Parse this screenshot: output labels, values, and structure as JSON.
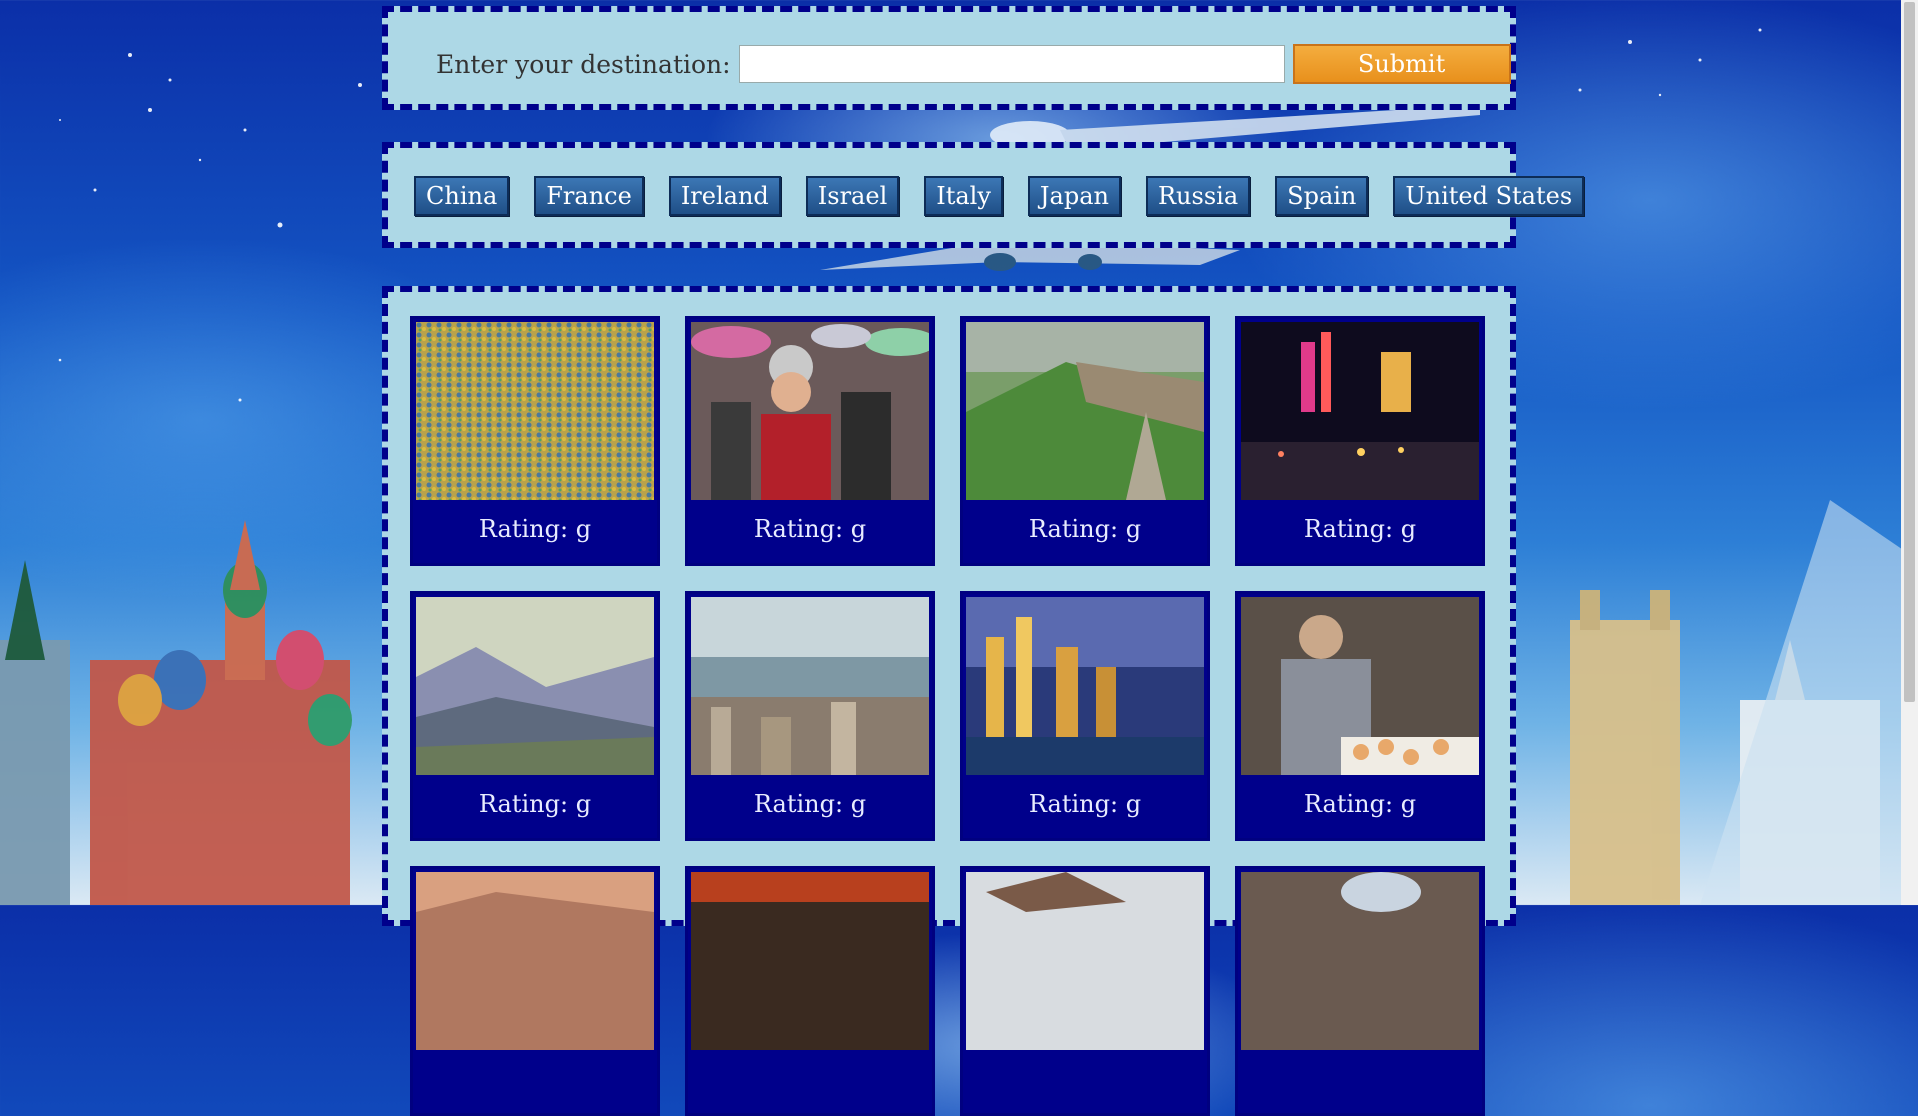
{
  "search": {
    "label": "Enter your destination:",
    "input_value": "",
    "input_placeholder": "",
    "submit_label": "Submit"
  },
  "countries": [
    "China",
    "France",
    "Ireland",
    "Israel",
    "Italy",
    "Japan",
    "Russia",
    "Spain",
    "United States"
  ],
  "results": [
    {
      "rating": "Rating: g",
      "scene": "crowd"
    },
    {
      "rating": "Rating: g",
      "scene": "festival-umbrellas"
    },
    {
      "rating": "Rating: g",
      "scene": "great-wall"
    },
    {
      "rating": "Rating: g",
      "scene": "night-street"
    },
    {
      "rating": "Rating: g",
      "scene": "misty-mountains"
    },
    {
      "rating": "Rating: g",
      "scene": "harbor-city"
    },
    {
      "rating": "Rating: g",
      "scene": "skyline-night"
    },
    {
      "rating": "Rating: g",
      "scene": "chess-player"
    },
    {
      "rating": "",
      "scene": "sunset-hills"
    },
    {
      "rating": "",
      "scene": "market"
    },
    {
      "rating": "",
      "scene": "boat"
    },
    {
      "rating": "",
      "scene": "hands"
    }
  ],
  "colors": {
    "panel_bg": "#add8e6",
    "panel_border": "#00008b",
    "card_bg": "#00008b",
    "submit_bg": "#f0a030",
    "country_btn_bg": "#2a5f9e"
  }
}
